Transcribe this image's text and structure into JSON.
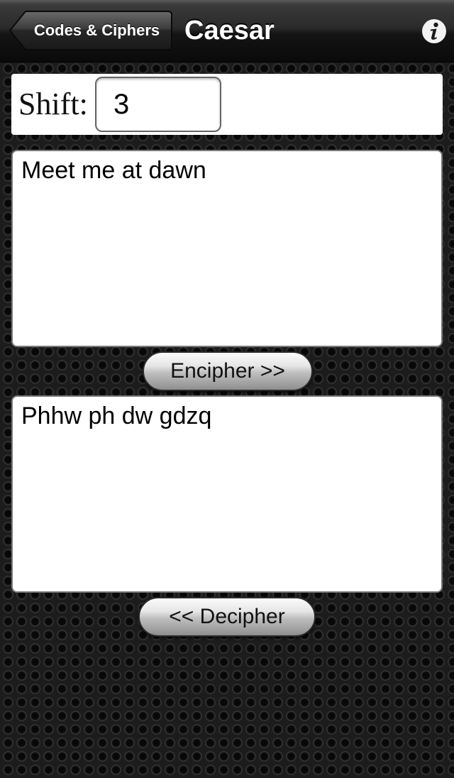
{
  "navbar": {
    "back_label": "Codes & Ciphers",
    "title": "Caesar",
    "info_icon": "info-icon"
  },
  "shift": {
    "label": "Shift:",
    "value": "3"
  },
  "plaintext": {
    "value": "Meet me at dawn"
  },
  "encipher_button": {
    "label": "Encipher >>"
  },
  "ciphertext": {
    "value": "Phhw ph dw gdzq"
  },
  "decipher_button": {
    "label": "<< Decipher"
  },
  "colors": {
    "navbar_dark": "#0a0a0a",
    "background": "#1c1c1c",
    "panel": "#ffffff"
  }
}
